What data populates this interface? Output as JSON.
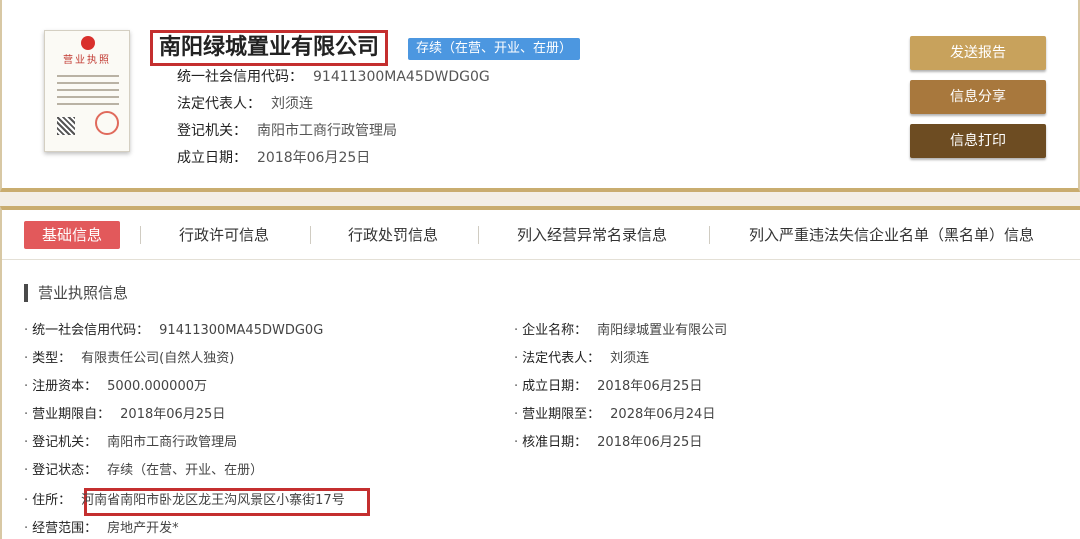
{
  "header": {
    "license_title": "营业执照",
    "company_name": "南阳绿城置业有限公司",
    "status_badge": "存续（在营、开业、在册）",
    "rows": [
      {
        "label": "统一社会信用代码：",
        "value": "91411300MA45DWDG0G"
      },
      {
        "label": "法定代表人：",
        "value": "刘须连"
      },
      {
        "label": "登记机关：",
        "value": "南阳市工商行政管理局"
      },
      {
        "label": "成立日期：",
        "value": "2018年06月25日"
      }
    ],
    "buttons": {
      "report": "发送报告",
      "share": "信息分享",
      "print": "信息打印"
    }
  },
  "tabs": [
    {
      "label": "基础信息"
    },
    {
      "label": "行政许可信息"
    },
    {
      "label": "行政处罚信息"
    },
    {
      "label": "列入经营异常名录信息"
    },
    {
      "label": "列入严重违法失信企业名单（黑名单）信息"
    }
  ],
  "section": {
    "title": "营业执照信息",
    "left_fields": [
      {
        "label": "统一社会信用代码：",
        "value": "91411300MA45DWDG0G"
      },
      {
        "label": "类型：",
        "value": "有限责任公司(自然人独资)"
      },
      {
        "label": "注册资本：",
        "value": "5000.000000万"
      },
      {
        "label": "营业期限自：",
        "value": "2018年06月25日"
      },
      {
        "label": "登记机关：",
        "value": "南阳市工商行政管理局"
      },
      {
        "label": "登记状态：",
        "value": "存续（在营、开业、在册）"
      },
      {
        "label": "住所：",
        "value": "河南省南阳市卧龙区龙王沟风景区小寨街17号"
      },
      {
        "label": "经营范围：",
        "value": "房地产开发*"
      }
    ],
    "right_fields": [
      {
        "label": "企业名称：",
        "value": "南阳绿城置业有限公司"
      },
      {
        "label": "法定代表人：",
        "value": "刘须连"
      },
      {
        "label": "成立日期：",
        "value": "2018年06月25日"
      },
      {
        "label": "营业期限至：",
        "value": "2028年06月24日"
      },
      {
        "label": "核准日期：",
        "value": "2018年06月25日"
      }
    ]
  },
  "colors": {
    "accent_gold": "#c9ad6f",
    "badge_blue": "#4c97e0",
    "active_tab": "#e2595b",
    "highlight_red": "#c42f2f"
  }
}
